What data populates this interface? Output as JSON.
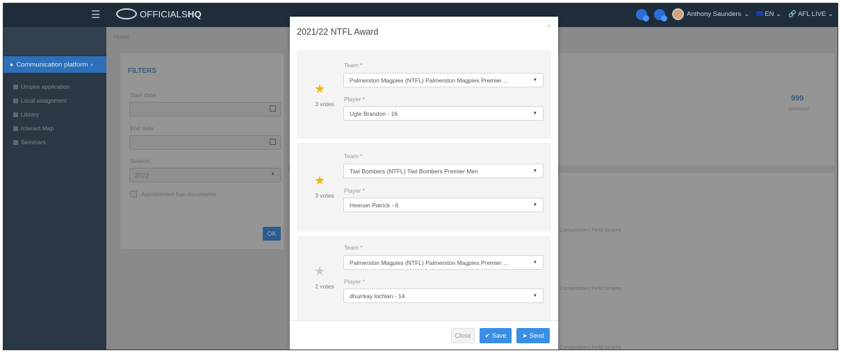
{
  "navbar": {
    "menu_icon": "hamburger-icon",
    "logo_text_light": "OFFICIALS",
    "logo_text_bold": "HQ",
    "user_name": "Anthony Saunders",
    "language": "EN",
    "platform": "AFL LIVE"
  },
  "sidebar": {
    "active_item": "Communication platform",
    "items": [
      "Umpire application",
      "Local assignment",
      "Library",
      "Interact Map",
      "Seminars"
    ]
  },
  "content": {
    "breadcrumb": "Home",
    "filters": {
      "title": "FILTERS",
      "start_date_label": "Start date",
      "end_date_label": "End date",
      "season_label": "Season",
      "season_value": "2022",
      "checkbox_label": "Appointment has documents",
      "ok_label": "OK"
    },
    "stat": {
      "value": "999",
      "label": "Distance"
    },
    "bg_rows": [
      "Competition | Field Umpire",
      "Competition | Field Umpire",
      "Competition | Field Umpire"
    ]
  },
  "modal": {
    "title": "2021/22 NTFL Award",
    "team_label": "Team *",
    "player_label": "Player *",
    "awards": [
      {
        "votes": "3 votes",
        "team": "Palmerston Magpies (NTFL) Palmerston Magpies Premier ...",
        "player": "Ugle Brandon - 16",
        "star_color": "#f2b705"
      },
      {
        "votes": "3 votes",
        "team": "Tiwi Bombers (NTFL) Tiwi Bombers Premier Men",
        "player": "Heenan Patrick - 6",
        "star_color": "#f2b705"
      },
      {
        "votes": "2 votes",
        "team": "Palmerston Magpies (NTFL) Palmerston Magpies Premier ...",
        "player": "dhurrkay lochlan - 14",
        "star_color": "#c8c8c8"
      }
    ],
    "buttons": {
      "close": "Close",
      "save": "Save",
      "send": "Send"
    }
  }
}
